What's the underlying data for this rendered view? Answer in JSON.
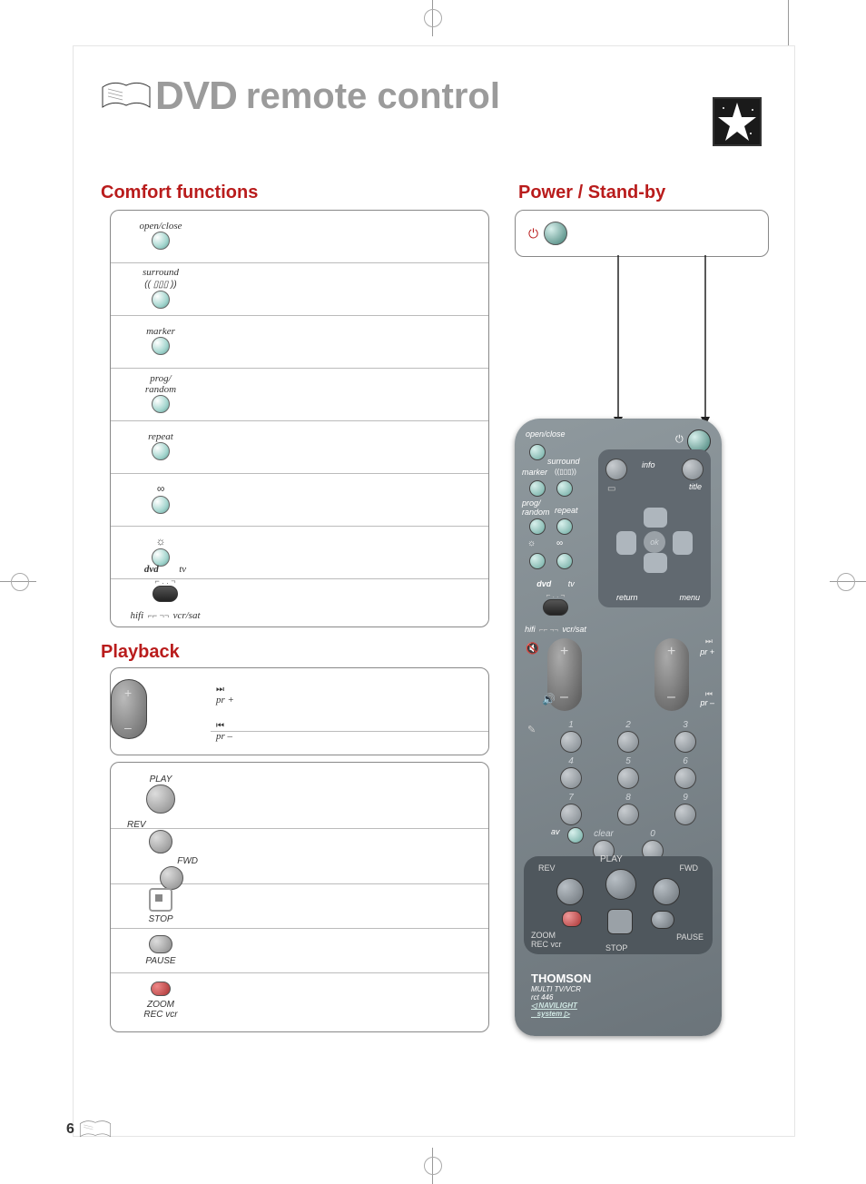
{
  "header": {
    "title_prefix": "DVD",
    "title_rest": "remote control"
  },
  "sections": {
    "comfort": "Comfort functions",
    "power": "Power / Stand-by",
    "playback": "Playback"
  },
  "comfort_rows": [
    {
      "label": "open/close"
    },
    {
      "label": "surround"
    },
    {
      "label": "marker"
    },
    {
      "label": "prog/\nrandom"
    },
    {
      "label": "repeat"
    },
    {
      "label": ""
    },
    {
      "label": ""
    }
  ],
  "mode_switch": {
    "top_left": "dvd",
    "top_right": "tv",
    "bottom_left": "hifi",
    "bottom_right": "vcr/sat"
  },
  "playback_rows1": {
    "pr_plus": "pr +",
    "pr_minus": "pr –"
  },
  "playback_rows2": [
    "PLAY",
    "REV",
    "FWD",
    "STOP",
    "PAUSE",
    "ZOOM",
    "REC vcr"
  ],
  "remote": {
    "open_close": "open/close",
    "surround": "surround",
    "marker": "marker",
    "prog_random": "prog/\nrandom",
    "repeat": "repeat",
    "dvd": "dvd",
    "tv": "tv",
    "hifi": "hifi",
    "vcr_sat": "vcr/sat",
    "info": "info",
    "title": "title",
    "ok": "ok",
    "return": "return",
    "menu": "menu",
    "pr_plus": "pr +",
    "pr_minus": "pr –",
    "clear": "clear",
    "av": "av",
    "play": "PLAY",
    "rev": "REV",
    "fwd": "FWD",
    "stop": "STOP",
    "pause": "PAUSE",
    "zoom": "ZOOM",
    "rec": "REC vcr",
    "brand": "THOMSON",
    "model": "MULTI TV/VCR\nrct 446",
    "navilight": "NAVILIGHT",
    "system": "system",
    "digits": [
      "1",
      "2",
      "3",
      "4",
      "5",
      "6",
      "7",
      "8",
      "9",
      "0"
    ]
  },
  "footer": {
    "page": "6"
  }
}
